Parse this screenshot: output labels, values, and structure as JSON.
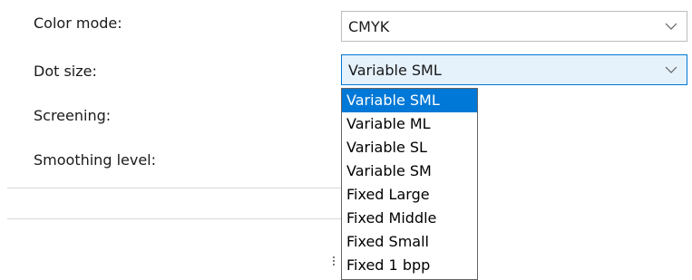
{
  "fields": {
    "color_mode": {
      "label": "Color mode:",
      "value": "CMYK"
    },
    "dot_size": {
      "label": "Dot size:",
      "value": "Variable SML"
    },
    "screening": {
      "label": "Screening:"
    },
    "smoothing_level": {
      "label": "Smoothing level:"
    }
  },
  "dropdown": {
    "selected_index": 0,
    "options": [
      "Variable SML",
      "Variable ML",
      "Variable SL",
      "Variable SM",
      "Fixed Large",
      "Fixed Middle",
      "Fixed Small",
      "Fixed 1 bpp"
    ]
  },
  "icons": {
    "select_chevron": "chevron-down-icon"
  },
  "colors": {
    "accent": "#0078d7",
    "active_field_bg": "#e5f1fb",
    "selected_option_text": "#ffffff"
  }
}
